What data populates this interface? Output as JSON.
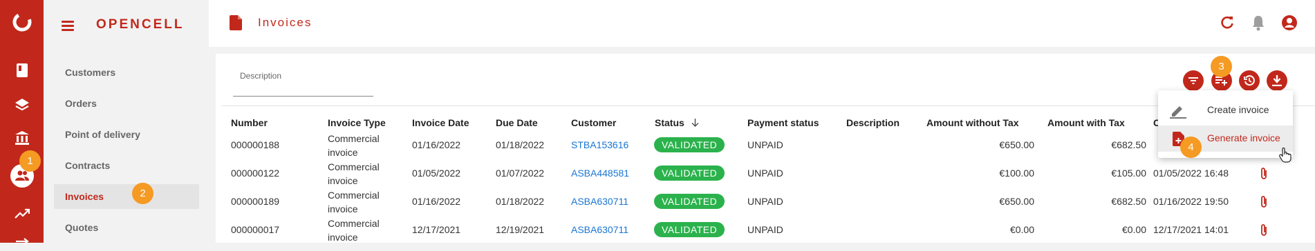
{
  "app": {
    "brand": "OPENCELL",
    "page_title": "Invoices"
  },
  "sidebar": {
    "items": [
      {
        "label": "Customers"
      },
      {
        "label": "Orders"
      },
      {
        "label": "Point of delivery"
      },
      {
        "label": "Contracts"
      },
      {
        "label": "Invoices",
        "active": true
      },
      {
        "label": "Quotes"
      }
    ]
  },
  "filter": {
    "label": "Description"
  },
  "table": {
    "columns": [
      "Number",
      "Invoice Type",
      "Invoice Date",
      "Due Date",
      "Customer",
      "Status",
      "Payment status",
      "Description",
      "Amount without Tax",
      "Amount with Tax"
    ],
    "rows": [
      {
        "number": "000000188",
        "type": "Commercial invoice",
        "invoice_date": "01/16/2022",
        "due_date": "01/18/2022",
        "customer": "STBA153616",
        "status": "VALIDATED",
        "payment": "UNPAID",
        "description": "",
        "amount_wo_tax": "€650.00",
        "amount_w_tax": "€682.50",
        "date2": ""
      },
      {
        "number": "000000122",
        "type": "Commercial invoice",
        "invoice_date": "01/05/2022",
        "due_date": "01/07/2022",
        "customer": "ASBA448581",
        "status": "VALIDATED",
        "payment": "UNPAID",
        "description": "",
        "amount_wo_tax": "€100.00",
        "amount_w_tax": "€105.00",
        "date2": "01/05/2022 16:48"
      },
      {
        "number": "000000189",
        "type": "Commercial invoice",
        "invoice_date": "01/16/2022",
        "due_date": "01/18/2022",
        "customer": "ASBA630711",
        "status": "VALIDATED",
        "payment": "UNPAID",
        "description": "",
        "amount_wo_tax": "€650.00",
        "amount_w_tax": "€682.50",
        "date2": "01/16/2022 19:50"
      },
      {
        "number": "000000017",
        "type": "Commercial invoice",
        "invoice_date": "12/17/2021",
        "due_date": "12/19/2021",
        "customer": "ASBA630711",
        "status": "VALIDATED",
        "payment": "UNPAID",
        "description": "",
        "amount_wo_tax": "€0.00",
        "amount_w_tax": "€0.00",
        "date2": "12/17/2021 14:01"
      }
    ]
  },
  "menu": {
    "items": [
      {
        "label": "Create invoice"
      },
      {
        "label": "Generate invoice"
      }
    ]
  },
  "markers": [
    "1",
    "2",
    "3",
    "4"
  ],
  "colors": {
    "brand": "#c1281b",
    "status_green": "#2bb24c",
    "link": "#1976d2",
    "marker": "#f59a23"
  }
}
